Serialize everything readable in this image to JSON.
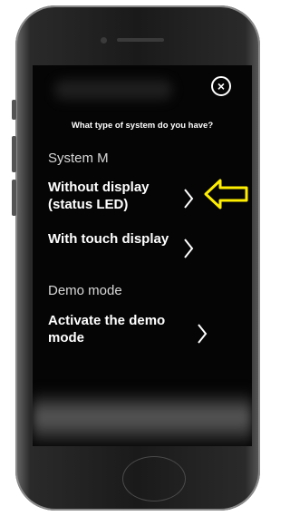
{
  "dialog": {
    "close_icon": "close-circle-icon",
    "question": "What type of system do you have?",
    "sections": [
      {
        "heading": "System M",
        "options": [
          {
            "label": "Without display (status LED)",
            "icon": "chevron-right-icon"
          },
          {
            "label": "With touch display",
            "icon": "chevron-right-icon"
          }
        ]
      },
      {
        "heading": "Demo mode",
        "options": [
          {
            "label": "Activate the demo mode",
            "icon": "chevron-right-icon"
          }
        ]
      }
    ]
  },
  "annotation": {
    "icon": "arrow-left-icon",
    "color": "#ffee00"
  }
}
